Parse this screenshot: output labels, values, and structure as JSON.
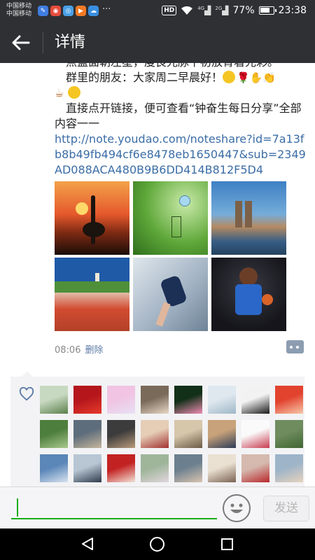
{
  "status_bar": {
    "carrier_1": "中国移动",
    "carrier_2": "中国移动",
    "more": "···",
    "hd": "HD",
    "net_1": "4G",
    "net_2": "2G",
    "battery": "77%",
    "battery_level": 0.77,
    "time": "23:38"
  },
  "title_bar": {
    "back_icon": "back-arrow-icon",
    "title": "详情"
  },
  "post": {
    "line_cut": "点蓝面朝左星，度良光脉下初放背着光彩。",
    "line_1": "群里的朋友：大家周二早晨好！",
    "line_3": "直接点开链接，便可查看“钟奋生每日分享”全部内容一一",
    "link": "http://note.youdao.com/noteshare?id=7a13fb8b49fb494cf6e8478eb1650447&sub=2349AD088ACA480B9B6DD414B812F5D4",
    "time": "08:06",
    "delete": "删除"
  },
  "input_bar": {
    "placeholder": "",
    "send": "发送"
  },
  "colors": {
    "accent": "#1aad19",
    "link": "#3b6da6",
    "header": "#2e3033"
  }
}
